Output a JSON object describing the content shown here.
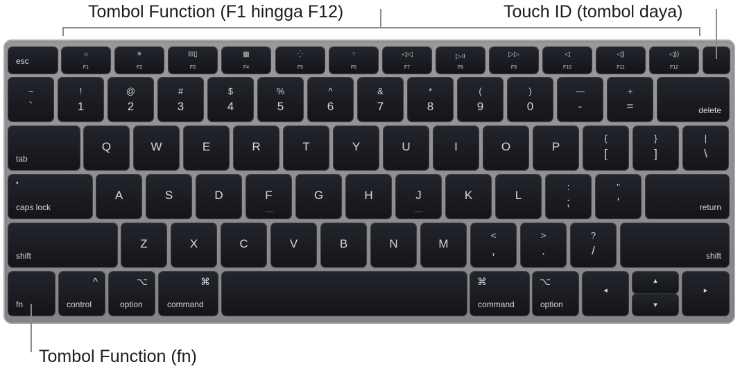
{
  "callouts": {
    "function_keys": "Tombol Function (F1 hingga F12)",
    "touch_id": "Touch ID (tombol daya)",
    "fn_key": "Tombol Function (fn)"
  },
  "colors": {
    "key": "#1a1b20",
    "body": "#8e8e90",
    "legend": "#d8d8da",
    "leader": "#8a8a8a"
  },
  "rows": {
    "fn": {
      "esc": "esc",
      "keys": [
        {
          "icon": "☼",
          "label": "F1",
          "icon_name": "brightness-down-icon"
        },
        {
          "icon": "☀",
          "label": "F2",
          "icon_name": "brightness-up-icon"
        },
        {
          "icon": "⊟▯",
          "label": "F3",
          "icon_name": "mission-control-icon"
        },
        {
          "icon": "▦",
          "label": "F4",
          "icon_name": "launchpad-icon"
        },
        {
          "icon": "⁛",
          "label": "F5",
          "icon_name": "keyboard-backlight-down-icon"
        },
        {
          "icon": "⁘",
          "label": "F6",
          "icon_name": "keyboard-backlight-up-icon"
        },
        {
          "icon": "◁◁",
          "label": "F7",
          "icon_name": "rewind-icon"
        },
        {
          "icon": "▷॥",
          "label": "F8",
          "icon_name": "play-pause-icon"
        },
        {
          "icon": "▷▷",
          "label": "F9",
          "icon_name": "fast-forward-icon"
        },
        {
          "icon": "◁",
          "label": "F10",
          "icon_name": "mute-icon"
        },
        {
          "icon": "◁)",
          "label": "F11",
          "icon_name": "volume-down-icon"
        },
        {
          "icon": "◁))",
          "label": "F12",
          "icon_name": "volume-up-icon"
        }
      ]
    },
    "number": {
      "keys": [
        {
          "top": "~",
          "bot": "`"
        },
        {
          "top": "!",
          "bot": "1"
        },
        {
          "top": "@",
          "bot": "2"
        },
        {
          "top": "#",
          "bot": "3"
        },
        {
          "top": "$",
          "bot": "4"
        },
        {
          "top": "%",
          "bot": "5"
        },
        {
          "top": "^",
          "bot": "6"
        },
        {
          "top": "&",
          "bot": "7"
        },
        {
          "top": "*",
          "bot": "8"
        },
        {
          "top": "(",
          "bot": "9"
        },
        {
          "top": ")",
          "bot": "0"
        },
        {
          "top": "—",
          "bot": "-"
        },
        {
          "top": "+",
          "bot": "="
        }
      ],
      "delete": "delete"
    },
    "qwerty": {
      "tab": "tab",
      "letters": [
        "Q",
        "W",
        "E",
        "R",
        "T",
        "Y",
        "U",
        "I",
        "O",
        "P"
      ],
      "brackets": [
        {
          "top": "{",
          "bot": "["
        },
        {
          "top": "}",
          "bot": "]"
        },
        {
          "top": "|",
          "bot": "\\"
        }
      ]
    },
    "home": {
      "caps": "caps lock",
      "caps_dot": "•",
      "letters": [
        "A",
        "S",
        "D",
        "F",
        "G",
        "H",
        "J",
        "K",
        "L"
      ],
      "punct": [
        {
          "top": ":",
          "bot": ";"
        },
        {
          "top": "\"",
          "bot": "'"
        }
      ],
      "return": "return"
    },
    "shift": {
      "left": "shift",
      "letters": [
        "Z",
        "X",
        "C",
        "V",
        "B",
        "N",
        "M"
      ],
      "punct": [
        {
          "top": "<",
          "bot": ","
        },
        {
          "top": ">",
          "bot": "."
        },
        {
          "top": "?",
          "bot": "/"
        }
      ],
      "right": "shift"
    },
    "bottom": {
      "fn": "fn",
      "control": {
        "sym": "^",
        "label": "control"
      },
      "option_l": {
        "sym": "⌥",
        "label": "option"
      },
      "command_l": {
        "sym": "⌘",
        "label": "command"
      },
      "command_r": {
        "sym": "⌘",
        "label": "command"
      },
      "option_r": {
        "sym": "⌥",
        "label": "option"
      },
      "arrows": {
        "left": "◂",
        "up": "▴",
        "down": "▾",
        "right": "▸"
      }
    }
  }
}
